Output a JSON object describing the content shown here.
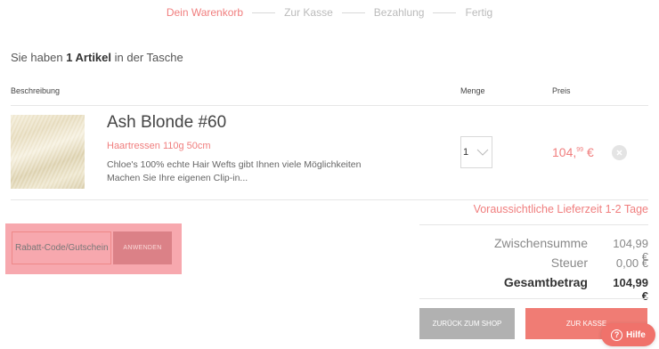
{
  "steps": [
    {
      "label": "Dein Warenkorb",
      "active": true
    },
    {
      "label": "Zur Kasse"
    },
    {
      "label": "Bezahlung"
    },
    {
      "label": "Fertig"
    }
  ],
  "cart_summary": {
    "prefix": "Sie haben",
    "count": "1 Artikel",
    "suffix": "in der Tasche"
  },
  "table": {
    "col_description": "Beschreibung",
    "col_quantity": "Menge",
    "col_price": "Preis"
  },
  "item": {
    "name": "Ash Blonde #60",
    "subtitle": "Haartressen 110g 50cm",
    "description": "Chloe's 100% echte Hair Wefts gibt Ihnen viele Möglichkeiten Machen Sie Ihre eigenen Clip-in...",
    "quantity": "1",
    "price_main": "104,",
    "price_cents": "99",
    "price_currency": "€",
    "image_icon": "hair-swatch-image",
    "remove_icon": "close-icon"
  },
  "delivery": "Voraussichtliche Lieferzeit 1-2 Tage",
  "coupon": {
    "placeholder": "Rabatt-Code/Gutschein",
    "apply_label": "ANWENDEN"
  },
  "totals": {
    "subtotal_label": "Zwischensumme",
    "subtotal_value": "104,99 €",
    "tax_label": "Steuer",
    "tax_value": "0,00 €",
    "total_label": "Gesamtbetrag",
    "total_value": "104,99 €"
  },
  "buttons": {
    "back": "ZURÜCK ZUM SHOP",
    "checkout": "ZUR KASSE"
  },
  "help": {
    "label": "Hilfe",
    "icon": "question-icon"
  },
  "colors": {
    "accent": "#f07e7e",
    "highlight": "#f7a8ae",
    "button_grey": "#b1b1b1"
  }
}
